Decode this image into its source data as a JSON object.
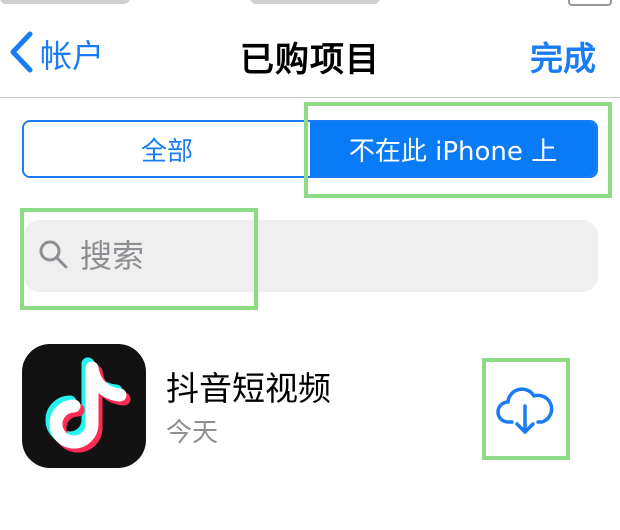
{
  "nav": {
    "back_label": "帐户",
    "title": "已购项目",
    "done_label": "完成"
  },
  "segments": {
    "all_label": "全部",
    "not_on_device_label": "不在此 iPhone 上",
    "selected": "not_on_device"
  },
  "search": {
    "placeholder": "搜索",
    "value": ""
  },
  "apps": [
    {
      "name": "抖音短视频",
      "date": "今天",
      "icon": "tiktok-logo",
      "action_icon": "cloud-download-icon"
    }
  ],
  "colors": {
    "accent": "#1a7cf5",
    "highlight": "#8edb86",
    "search_bg": "#efeff0"
  }
}
